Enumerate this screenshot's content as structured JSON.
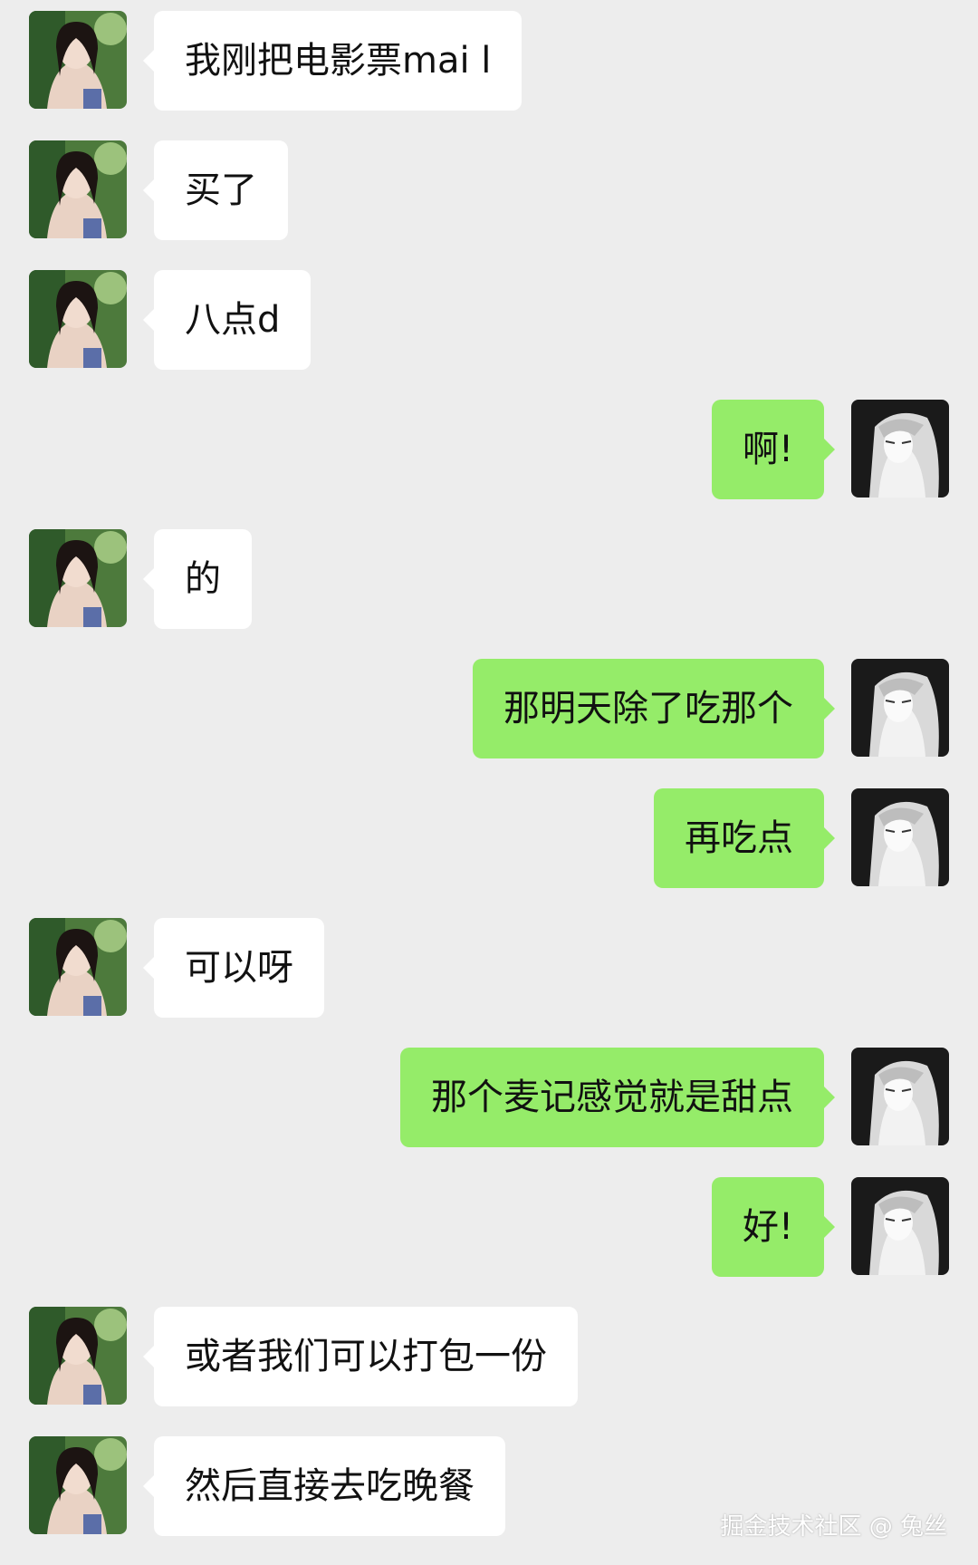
{
  "colors": {
    "background": "#ededed",
    "incoming_bubble": "#ffffff",
    "outgoing_bubble": "#95ec69",
    "text": "#111111"
  },
  "avatars": {
    "incoming": "girl-photo-avatar",
    "outgoing": "anime-character-avatar"
  },
  "messages": [
    {
      "side": "left",
      "text": "我刚把电影票mai l"
    },
    {
      "side": "left",
      "text": "买了"
    },
    {
      "side": "left",
      "text": "八点d"
    },
    {
      "side": "right",
      "text": "啊!"
    },
    {
      "side": "left",
      "text": "的"
    },
    {
      "side": "right",
      "text": "那明天除了吃那个"
    },
    {
      "side": "right",
      "text": "再吃点"
    },
    {
      "side": "left",
      "text": "可以呀"
    },
    {
      "side": "right",
      "text": "那个麦记感觉就是甜点"
    },
    {
      "side": "right",
      "text": "好!"
    },
    {
      "side": "left",
      "text": "或者我们可以打包一份"
    },
    {
      "side": "left",
      "text": "然后直接去吃晚餐"
    }
  ],
  "watermark": "掘金技术社区 @ 兔丝"
}
